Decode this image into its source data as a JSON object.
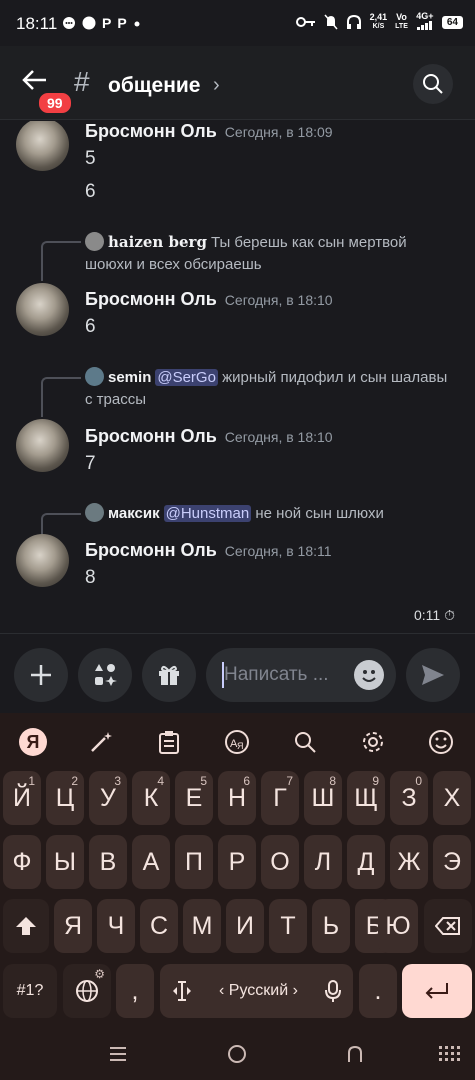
{
  "status_bar": {
    "time": "18:11",
    "notif_icons": [
      "chat-icon",
      "circle-icon",
      "p-icon",
      "p-icon",
      "dot-icon"
    ],
    "net_speed_value": "2,41",
    "net_speed_unit": "K/S",
    "vo_top": "Vo",
    "vo_bottom": "LTE",
    "network": "4G+",
    "battery": "64"
  },
  "header": {
    "unread_count": "99",
    "channel_name": "общение"
  },
  "messages": [
    {
      "author": "Бросмонн Оль",
      "timestamp": "Сегодня, в 18:09",
      "lines": [
        "5",
        "6"
      ]
    },
    {
      "reply": {
        "user": "haizen berg",
        "mention": "",
        "text": "Ты берешь как сын мертвой шоюхи и всех обсираешь"
      },
      "author": "Бросмонн Оль",
      "timestamp": "Сегодня, в 18:10",
      "lines": [
        "6"
      ]
    },
    {
      "reply": {
        "user": "semin",
        "mention": "@SerGo",
        "text": "жирный пидофил и сын шалавы с трассы"
      },
      "author": "Бросмонн Оль",
      "timestamp": "Сегодня, в 18:10",
      "lines": [
        "7"
      ]
    },
    {
      "reply": {
        "user": "максик",
        "mention": "@Hunstman",
        "text": "не ной сын шлюхи"
      },
      "author": "Бросмонн Оль",
      "timestamp": "Сегодня, в 18:11",
      "lines": [
        "8"
      ]
    }
  ],
  "slowmode_timer": "0:11",
  "composer": {
    "placeholder": "Написать ..."
  },
  "keyboard": {
    "toolbar_icons": [
      "yandex-icon",
      "magic-wand-icon",
      "clipboard-icon",
      "translate-icon",
      "search-icon",
      "settings-icon",
      "emoji-icon"
    ],
    "yandex_letter": "Я",
    "row1": [
      "Й",
      "Ц",
      "У",
      "К",
      "Е",
      "Н",
      "Г",
      "Ш",
      "Щ",
      "З",
      "Х"
    ],
    "row1_hints": [
      "1",
      "2",
      "3",
      "4",
      "5",
      "6",
      "7",
      "8",
      "9",
      "0",
      ""
    ],
    "row2": [
      "Ф",
      "Ы",
      "В",
      "А",
      "П",
      "Р",
      "О",
      "Л",
      "Д",
      "Ж",
      "Э"
    ],
    "row3": [
      "Я",
      "Ч",
      "С",
      "М",
      "И",
      "Т",
      "Ь",
      "Б",
      "Ю"
    ],
    "symbols_label": "#1?",
    "comma": ",",
    "language_label": "‹ Русский ›",
    "period": "."
  }
}
